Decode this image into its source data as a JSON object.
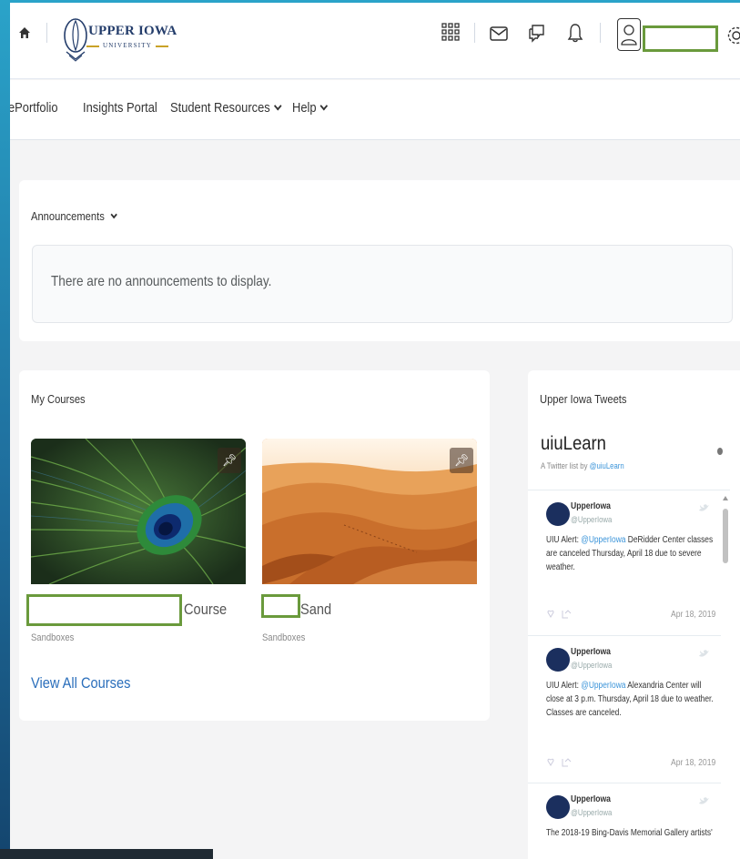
{
  "header": {
    "logo_title": "UPPER IOWA",
    "logo_subtitle": "UNIVERSITY"
  },
  "nav": {
    "items": [
      {
        "label": "ePortfolio"
      },
      {
        "label": "Insights Portal"
      },
      {
        "label": "Student Resources"
      },
      {
        "label": "Help"
      }
    ]
  },
  "announcements": {
    "title": "Announcements",
    "empty_message": "There are no announcements to display."
  },
  "my_courses": {
    "title": "My Courses",
    "courses": [
      {
        "name": "Course",
        "category": "Sandboxes"
      },
      {
        "name": "Sand",
        "category": "Sandboxes"
      }
    ],
    "view_all": "View All Courses"
  },
  "tweets": {
    "title": "Upper Iowa Tweets",
    "list_name": "uiuLearn",
    "list_by": "A Twitter list by",
    "list_owner": "@uiuLearn",
    "items": [
      {
        "name": "UpperIowa",
        "handle": "@UpperIowa",
        "text_pre": "UIU Alert: ",
        "mention": "@UpperIowa",
        "text_post": " DeRidder Center classes are canceled Thursday, April 18 due to severe weather.",
        "date": "Apr 18, 2019"
      },
      {
        "name": "UpperIowa",
        "handle": "@UpperIowa",
        "text_pre": "UIU Alert: ",
        "mention": "@UpperIowa",
        "text_post": " Alexandria Center will close at 3 p.m. Thursday, April 18 due to weather. Classes are canceled.",
        "date": "Apr 18, 2019"
      },
      {
        "name": "UpperIowa",
        "handle": "@UpperIowa",
        "text_pre": "The 2018-19 Bing-Davis Memorial Gallery artists'",
        "mention": "",
        "text_post": "",
        "date": ""
      }
    ]
  },
  "colors": {
    "accent_green": "#6a9a3c",
    "link_blue": "#2a6ebb",
    "brand_navy": "#243d6b"
  }
}
